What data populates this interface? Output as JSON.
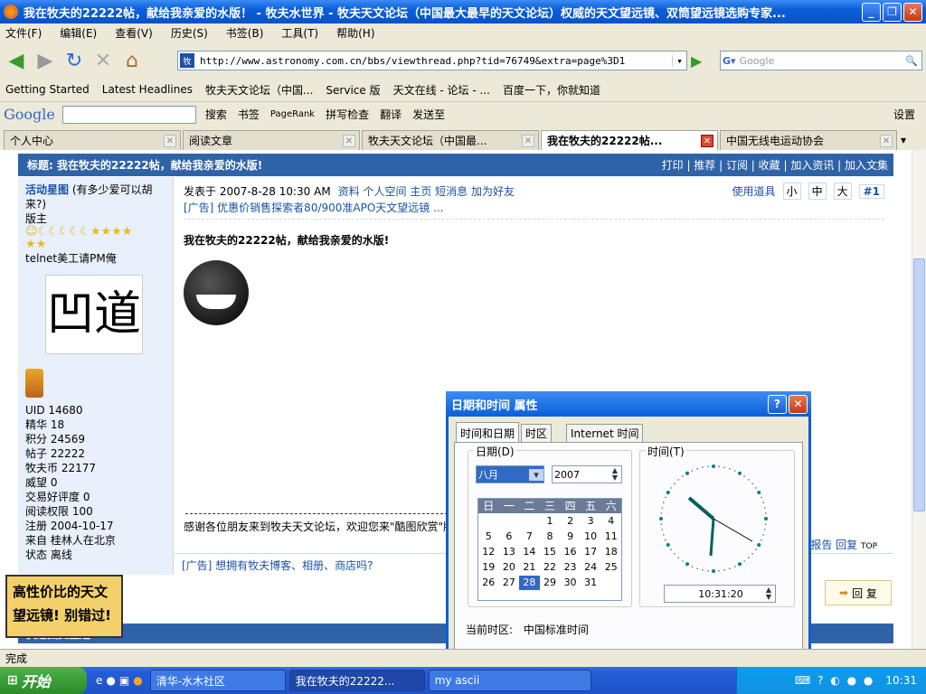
{
  "window": {
    "title": "我在牧夫的22222帖，献给我亲爱的水版！ - 牧夫水世界 - 牧夫天文论坛（中国最大最早的天文论坛）权威的天文望远镜、双筒望远镜选购专家..."
  },
  "menu": [
    "文件(F)",
    "编辑(E)",
    "查看(V)",
    "历史(S)",
    "书签(B)",
    "工具(T)",
    "帮助(H)"
  ],
  "address": {
    "url": "http://www.astronomy.com.cn/bbs/viewthread.php?tid=76749&extra=page%3D1",
    "search_placeholder": "Google"
  },
  "bookmarks": [
    "Getting Started",
    "Latest Headlines",
    "牧夫天文论坛（中国...",
    "Service 版",
    "天文在线 - 论坛 - ...",
    "百度一下，你就知道"
  ],
  "google_toolbar": {
    "logo": "Google",
    "items": [
      "搜索",
      "书签",
      "PageRank",
      "拼写检查",
      "翻译",
      "发送至",
      "设置"
    ]
  },
  "tabs": [
    {
      "label": "个人中心"
    },
    {
      "label": "阅读文章"
    },
    {
      "label": "牧夫天文论坛（中国最..."
    },
    {
      "label": "我在牧夫的22222帖..."
    },
    {
      "label": "中国无线电运动协会"
    }
  ],
  "thread": {
    "header": "标题: 我在牧夫的22222帖，献给我亲爱的水版!",
    "actions": "打印 | 推荐 | 订阅 | 收藏 | 加入资讯 | 加入文集",
    "user": {
      "name": "活动星图",
      "note": "(有多少爱可以胡来?)",
      "rank": "版主",
      "sig": "telnet美工请PM俺",
      "stats": [
        "UID 14680",
        "精华 18",
        "积分 24569",
        "帖子 22222",
        "牧夫币 22177",
        "威望 0",
        "交易好评度 0",
        "阅读权限 100",
        "注册 2004-10-17",
        "来自 桂林人在北京",
        "状态 离线"
      ]
    },
    "posted": "发表于 2007-8-28 10:30 AM",
    "post_links": "资料  个人空间  主页  短消息  加为好友",
    "tools": "使用道具",
    "sizes": [
      "小",
      "中",
      "大"
    ],
    "floor": "#1",
    "ad1": "[广告] 优惠价销售探索者80/900准APO天文望远镜 ...",
    "post_title": "我在牧夫的22222帖，献给我亲爱的水版!",
    "signature": "感谢各位朋友来到牧夫天文论坛，欢迎您来\"酷图欣赏\"版",
    "report": "报告 回复",
    "top": "TOP",
    "ad2": "[广告] 想拥有牧夫博客、相册、商店吗?",
    "reply_btn": "回 复",
    "quick_reply": "快速回复主题",
    "side_ad": [
      "高性价比的天文",
      "望远镜! 别错过!"
    ]
  },
  "dialog": {
    "title": "日期和时间 属性",
    "tabs": [
      "时间和日期",
      "时区",
      "Internet 时间"
    ],
    "date_group": "日期(D)",
    "time_group": "时间(T)",
    "month": "八月",
    "year": "2007",
    "weekdays": [
      "日",
      "一",
      "二",
      "三",
      "四",
      "五",
      "六"
    ],
    "days": [
      "",
      "",
      "",
      "1",
      "2",
      "3",
      "4",
      "5",
      "6",
      "7",
      "8",
      "9",
      "10",
      "11",
      "12",
      "13",
      "14",
      "15",
      "16",
      "17",
      "18",
      "19",
      "20",
      "21",
      "22",
      "23",
      "24",
      "25",
      "26",
      "27",
      "28",
      "29",
      "30",
      "31"
    ],
    "selected_day": "28",
    "time": "10:31:20",
    "tz_label": "当前时区:",
    "tz_value": "中国标准时间"
  },
  "status": "完成",
  "taskbar": {
    "start": "开始",
    "tasks": [
      "清华-水木社区",
      "我在牧夫的22222...",
      "my ascii"
    ],
    "clock": "10:31"
  }
}
